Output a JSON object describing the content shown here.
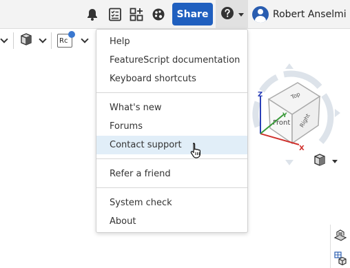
{
  "topbar": {
    "share_label": "Share",
    "user_name": "Robert Anselmi",
    "icons": [
      "bell-icon",
      "task-list-icon",
      "app-store-icon",
      "learning-center-icon",
      "help-icon",
      "user-avatar"
    ]
  },
  "toolbar": {
    "units_label": "Rc"
  },
  "help_menu": {
    "items": [
      {
        "label": "Help"
      },
      {
        "label": "FeatureScript documentation"
      },
      {
        "label": "Keyboard shortcuts"
      },
      {
        "label": "What's new"
      },
      {
        "label": "Forums"
      },
      {
        "label": "Contact support",
        "hovered": true
      },
      {
        "label": "Refer a friend"
      },
      {
        "label": "System check"
      },
      {
        "label": "About"
      }
    ]
  },
  "view_cube": {
    "faces": {
      "top": "Top",
      "front": "Front",
      "right": "Right"
    },
    "axes": {
      "x": "X",
      "y": "Y",
      "z": "Z"
    }
  },
  "colors": {
    "share_button": "#1f5fbf",
    "menu_hover": "#e1eef8",
    "axis_x": "#d0312d",
    "axis_y": "#3a9a3a",
    "axis_z": "#2a3fb8"
  }
}
